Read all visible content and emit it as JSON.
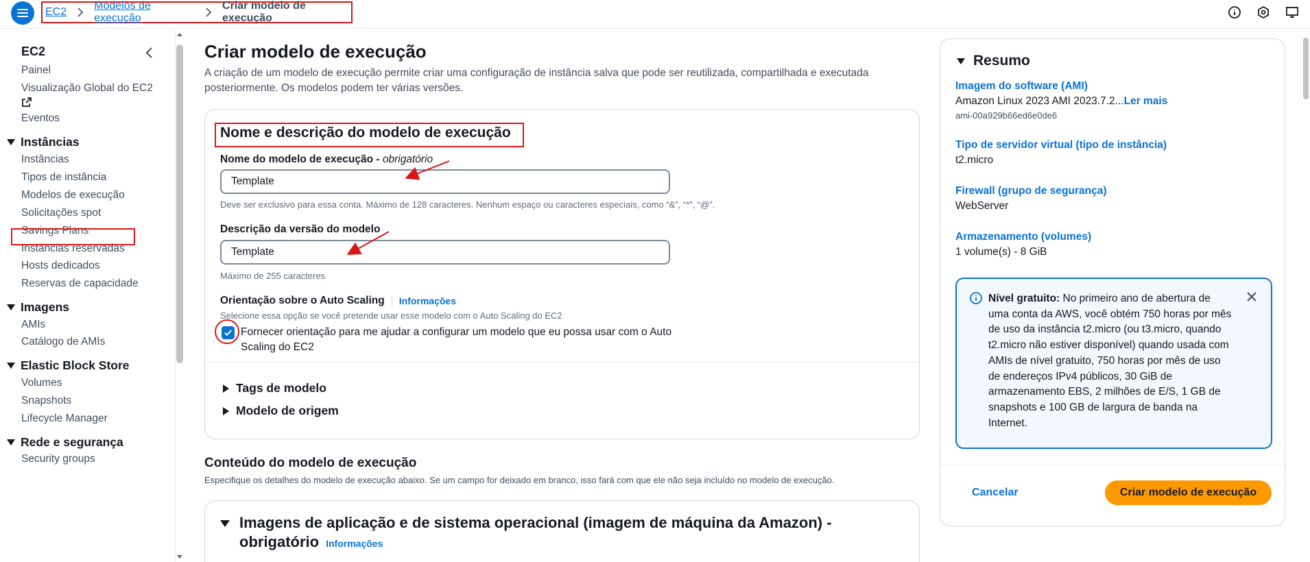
{
  "header": {
    "breadcrumbs": [
      "EC2",
      "Modelos de execução",
      "Criar modelo de execução"
    ]
  },
  "sidebar": {
    "title": "EC2",
    "items_top": [
      "Painel",
      "Visualização Global do EC2",
      "Eventos"
    ],
    "sections": [
      {
        "label": "Instâncias",
        "items": [
          "Instâncias",
          "Tipos de instância",
          "Modelos de execução",
          "Solicitações spot",
          "Savings Plans",
          "Instâncias reservadas",
          "Hosts dedicados",
          "Reservas de capacidade"
        ]
      },
      {
        "label": "Imagens",
        "items": [
          "AMIs",
          "Catálogo de AMIs"
        ]
      },
      {
        "label": "Elastic Block Store",
        "items": [
          "Volumes",
          "Snapshots",
          "Lifecycle Manager"
        ]
      },
      {
        "label": "Rede e segurança",
        "items": [
          "Security groups"
        ]
      }
    ]
  },
  "main": {
    "title": "Criar modelo de execução",
    "description": "A criação de um modelo de execução permite criar uma configuração de instância salva que pode ser reutilizada, compartilhada e executada posteriormente. Os modelos podem ter várias versões.",
    "name_section": {
      "title": "Nome e descrição do modelo de execução",
      "name_label": "Nome do modelo de execução - ",
      "name_required": "obrigatório",
      "name_value": "Template",
      "name_hint": "Deve ser exclusivo para essa conta. Máximo de 128 caracteres. Nenhum espaço ou caracteres especiais, como “&”, “*”, “@”.",
      "desc_label": "Descrição da versão do modelo",
      "desc_value": "Template",
      "desc_hint": "Máximo de 255 caracteres",
      "autoscaling_label": "Orientação sobre o Auto Scaling",
      "autoscaling_info": "Informações",
      "autoscaling_hint": "Selecione essa opção se você pretende usar esse modelo com o Auto Scaling do EC2",
      "autoscaling_checkbox": "Fornecer orientação para me ajudar a configurar um modelo que eu possa usar com o Auto Scaling do EC2",
      "autoscaling_checked": true,
      "expanders": [
        "Tags de modelo",
        "Modelo de origem"
      ]
    },
    "content_section": {
      "title": "Conteúdo do modelo de execução",
      "description": "Especifique os detalhes do modelo de execução abaixo. Se um campo for deixado em branco, isso fará com que ele não seja incluído no modelo de execução.",
      "ami_title": "Imagens de aplicação e de sistema operacional (imagem de máquina da Amazon) - obrigatório",
      "ami_info": "Informações"
    }
  },
  "summary": {
    "title": "Resumo",
    "ami_label": "Imagem do software (AMI)",
    "ami_value": "Amazon Linux 2023 AMI 2023.7.2...",
    "ami_more": "Ler mais",
    "ami_id": "ami-00a929b66ed6e0de6",
    "type_label": "Tipo de servidor virtual (tipo de instância)",
    "type_value": "t2.micro",
    "firewall_label": "Firewall (grupo de segurança)",
    "firewall_value": "WebServer",
    "storage_label": "Armazenamento (volumes)",
    "storage_value": "1 volume(s) - 8 GiB",
    "alert_bold": "Nível gratuito:",
    "alert_text": " No primeiro ano de abertura de uma conta da AWS, você obtém 750 horas por mês de uso da instância t2.micro (ou t3.micro, quando t2.micro não estiver disponível) quando usada com AMIs de nível gratuito, 750 horas por mês de uso de endereços IPv4 públicos, 30 GiB de armazenamento EBS, 2 milhões de E/S, 1 GB de snapshots e 100 GB de largura de banda na Internet.",
    "cancel_label": "Cancelar",
    "create_label": "Criar modelo de execução"
  },
  "colors": {
    "primary": "#0972d3",
    "annotation": "#d91515",
    "action": "#ff9900"
  }
}
